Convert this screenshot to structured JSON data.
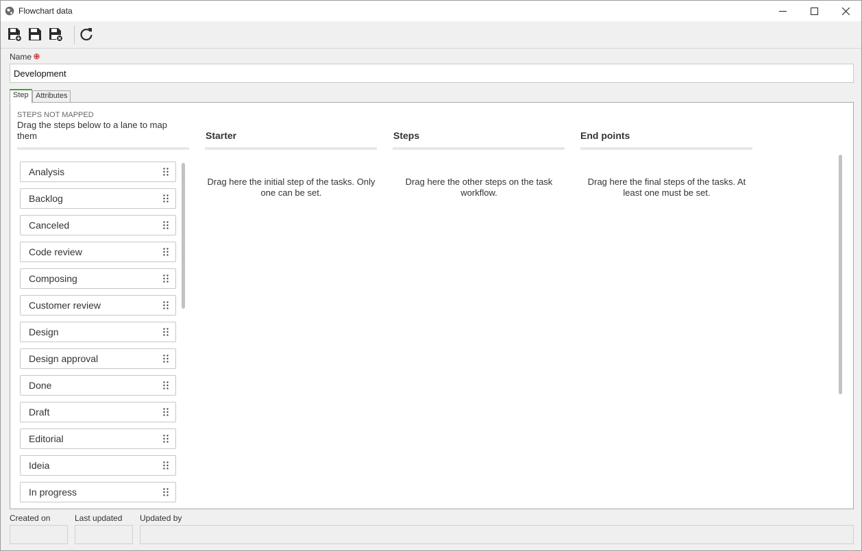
{
  "window": {
    "title": "Flowchart data"
  },
  "form": {
    "name_label": "Name",
    "name_value": "Development"
  },
  "tabs": [
    {
      "label": "Step"
    },
    {
      "label": "Attributes"
    }
  ],
  "unmapped": {
    "caption": "STEPS NOT MAPPED",
    "hint": "Drag the steps below to a lane to map them",
    "items": [
      {
        "label": "Analysis"
      },
      {
        "label": "Backlog"
      },
      {
        "label": "Canceled"
      },
      {
        "label": "Code review"
      },
      {
        "label": "Composing"
      },
      {
        "label": "Customer review"
      },
      {
        "label": "Design"
      },
      {
        "label": "Design approval"
      },
      {
        "label": "Done"
      },
      {
        "label": "Draft"
      },
      {
        "label": "Editorial"
      },
      {
        "label": "Ideia"
      },
      {
        "label": "In progress"
      }
    ]
  },
  "lanes": [
    {
      "title": "Starter",
      "hint": "Drag here the initial step of the tasks. Only one can be set."
    },
    {
      "title": "Steps",
      "hint": "Drag here the other steps on the task workflow."
    },
    {
      "title": "End points",
      "hint": "Drag here the final steps of the tasks. At least one must be set."
    }
  ],
  "footer": {
    "created_on_label": "Created on",
    "last_updated_label": "Last updated",
    "updated_by_label": "Updated by"
  },
  "icons": {
    "app": "globe-icon",
    "minimize": "minimize-icon",
    "maximize": "maximize-icon",
    "close": "close-icon",
    "save_new": "save-new-icon",
    "save": "save-icon",
    "save_close": "save-close-icon",
    "refresh": "refresh-icon",
    "required": "required-icon",
    "drag": "drag-handle-icon"
  },
  "colors": {
    "active_tab": "#3a9d3a",
    "required": "#d32f2f"
  }
}
